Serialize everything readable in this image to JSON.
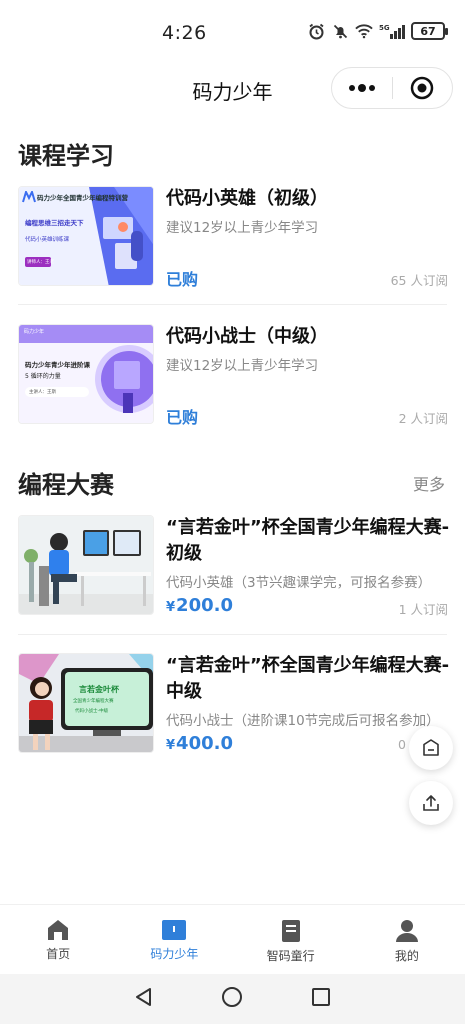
{
  "status": {
    "time": "4:26",
    "battery": "67",
    "signal": "5G"
  },
  "nav": {
    "title": "码力少年"
  },
  "courses": {
    "title": "课程学习",
    "items": [
      {
        "title": "代码小英雄（初级）",
        "subtitle": "建议12岁以上青少年学习",
        "status": "已购",
        "count": "65 人订阅",
        "thumb": {
          "banner": "码力少年全国青少年编程特训营",
          "line1": "编程思维三招走天下",
          "line2": "代码小英雄训练课",
          "badge": "讲师人：王老"
        }
      },
      {
        "title": "代码小战士（中级）",
        "subtitle": "建议12岁以上青少年学习",
        "status": "已购",
        "count": "2 人订阅",
        "thumb": {
          "banner": "码力少年",
          "line1": "码力少年青少年进阶课",
          "line2": "5 循环的力量",
          "badge": "主讲人：王斯"
        }
      }
    ]
  },
  "contests": {
    "title": "编程大赛",
    "more": "更多",
    "items": [
      {
        "title": "“言若金叶”杯全国青少年编程大赛-初级",
        "subtitle": "代码小英雄（3节兴趣课学完，可报名参赛）",
        "currency": "¥",
        "price": "200.0",
        "count": "1 人订阅"
      },
      {
        "title": "“言若金叶”杯全国青少年编程大赛-中级",
        "subtitle": "代码小战士（进阶课10节完成后可报名参加）",
        "currency": "¥",
        "price": "400.0",
        "count": "0",
        "thumb": {
          "line1": "言若金叶杯",
          "line2": "全国青少年编程大赛",
          "line3": "代码小战士-中级"
        }
      }
    ]
  },
  "tabs": [
    {
      "label": "首页",
      "icon": "home-icon"
    },
    {
      "label": "码力少年",
      "icon": "book-open-icon",
      "active": true
    },
    {
      "label": "智码童行",
      "icon": "notebook-icon"
    },
    {
      "label": "我的",
      "icon": "person-icon"
    }
  ],
  "colors": {
    "accent": "#2f7fd9",
    "text": "#222222",
    "muted": "#888888"
  }
}
